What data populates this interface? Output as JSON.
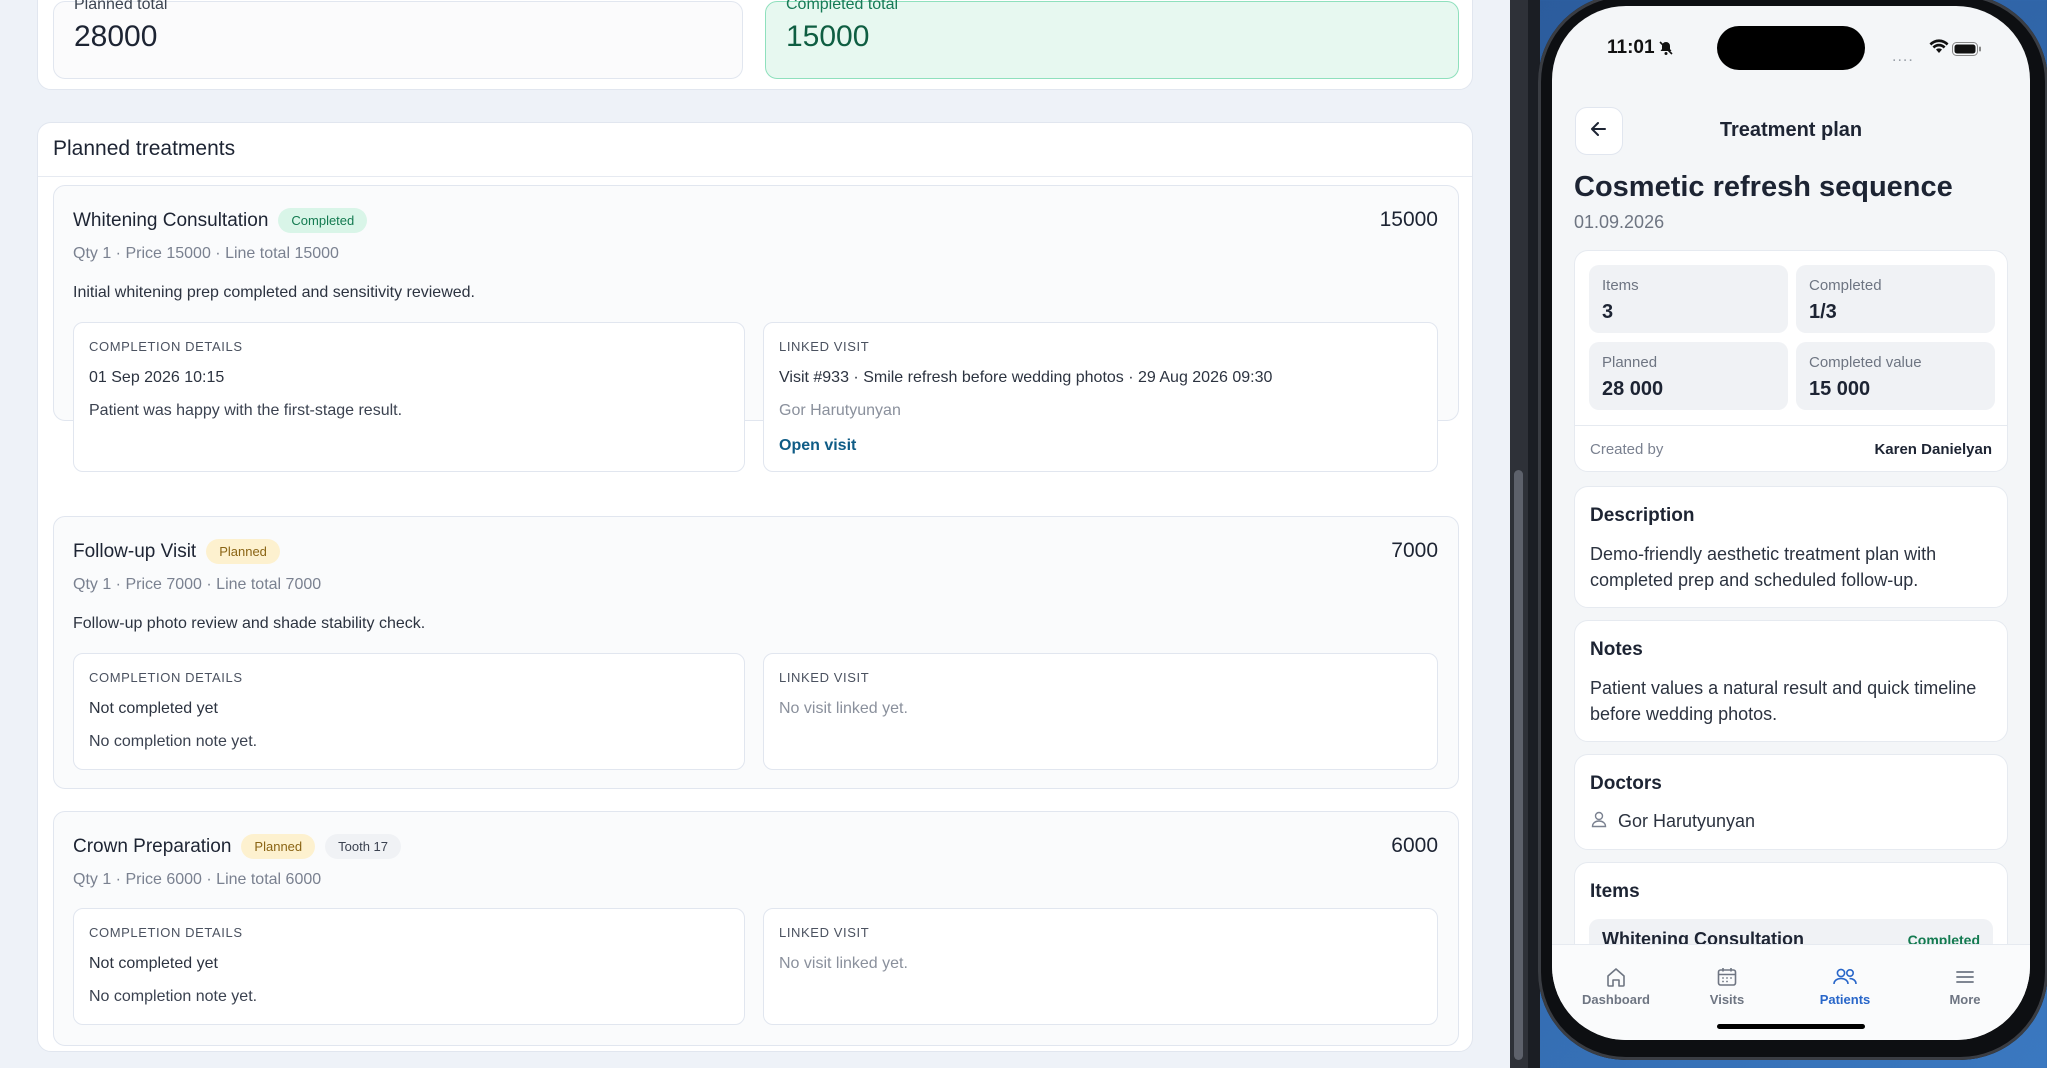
{
  "web": {
    "planned_total_label": "Planned total",
    "planned_total": "28000",
    "completed_total_label": "Completed total",
    "completed_total": "15000",
    "section_title": "Planned treatments",
    "items": [
      {
        "name": "Whitening Consultation",
        "status": "Completed",
        "amount": "15000",
        "meta": "Qty 1 · Price 15000 · Line total 15000",
        "note": "Initial whitening prep completed and sensitivity reviewed.",
        "completion_caption": "COMPLETION DETAILS",
        "completion_line1": "01 Sep 2026 10:15",
        "completion_line2": "Patient was happy with the first-stage result.",
        "visit_caption": "LINKED VISIT",
        "visit_line1": "Visit #933 · Smile refresh before wedding photos · 29 Aug 2026 09:30",
        "visit_line2": "Gor Harutyunyan",
        "visit_link": "Open visit"
      },
      {
        "name": "Follow-up Visit",
        "status": "Planned",
        "amount": "7000",
        "meta": "Qty 1 · Price 7000 · Line total 7000",
        "note": "Follow-up photo review and shade stability check.",
        "completion_caption": "COMPLETION DETAILS",
        "completion_line1": "Not completed yet",
        "completion_line2": "No completion note yet.",
        "visit_caption": "LINKED VISIT",
        "visit_line1": "No visit linked yet."
      },
      {
        "name": "Crown Preparation",
        "status": "Planned",
        "tooth": "Tooth 17",
        "amount": "6000",
        "meta": "Qty 1 · Price 6000 · Line total 6000",
        "completion_caption": "COMPLETION DETAILS",
        "completion_line1": "Not completed yet",
        "completion_line2": "No completion note yet.",
        "visit_caption": "LINKED VISIT",
        "visit_line1": "No visit linked yet."
      }
    ]
  },
  "phone": {
    "status_time": "11:01",
    "status_dots": "....",
    "title": "Treatment plan",
    "plan_name": "Cosmetic refresh sequence",
    "plan_date": "01.09.2026",
    "stats": {
      "items_label": "Items",
      "items_value": "3",
      "completed_label": "Completed",
      "completed_value": "1/3",
      "planned_label": "Planned",
      "planned_value": "28 000",
      "completed_value_label": "Completed value",
      "completed_value_value": "15 000"
    },
    "created_by_label": "Created by",
    "created_by": "Karen Danielyan",
    "description_title": "Description",
    "description": "Demo-friendly aesthetic treatment plan with completed prep and scheduled follow-up.",
    "notes_title": "Notes",
    "notes": "Patient values a natural result and quick timeline before wedding photos.",
    "doctors_title": "Doctors",
    "doctor": "Gor Harutyunyan",
    "items_title": "Items",
    "item_peek": "Whitening Consultation",
    "item_peek_status": "Completed",
    "tabs": [
      {
        "label": "Dashboard",
        "icon": "home-icon"
      },
      {
        "label": "Visits",
        "icon": "calendar-icon"
      },
      {
        "label": "Patients",
        "icon": "users-icon"
      },
      {
        "label": "More",
        "icon": "menu-icon"
      }
    ],
    "active_tab": "Patients"
  },
  "colors": {
    "accent": "#2866c9",
    "completed_green": "#137a50",
    "planned_amber": "#8a6414",
    "link": "#0f5c86"
  }
}
